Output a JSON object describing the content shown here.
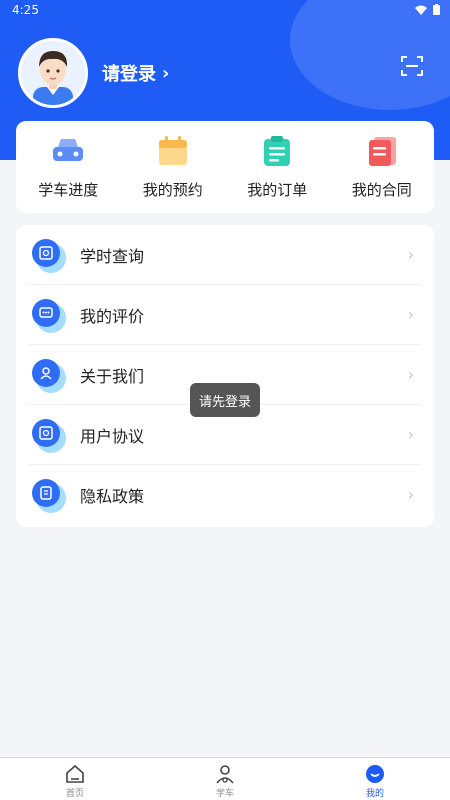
{
  "status_bar": {
    "time": "4:25"
  },
  "profile": {
    "login_text": "请登录",
    "chevron": "›"
  },
  "quick_actions": [
    {
      "label": "学车进度",
      "icon": "car-icon",
      "color": "#5b8cf7"
    },
    {
      "label": "我的预约",
      "icon": "calendar-icon",
      "color": "#f8c55a"
    },
    {
      "label": "我的订单",
      "icon": "clipboard-icon",
      "color": "#2fd0b4"
    },
    {
      "label": "我的合同",
      "icon": "document-icon",
      "color": "#f05a5a"
    }
  ],
  "menu": [
    {
      "label": "学时查询",
      "icon": "search-document-icon"
    },
    {
      "label": "我的评价",
      "icon": "comment-icon"
    },
    {
      "label": "关于我们",
      "icon": "user-icon"
    },
    {
      "label": "用户协议",
      "icon": "search-document-icon"
    },
    {
      "label": "隐私政策",
      "icon": "document-icon"
    }
  ],
  "toast": "请先登录",
  "tabs": [
    {
      "label": "首页",
      "icon": "home-icon",
      "active": false
    },
    {
      "label": "学车",
      "icon": "driver-icon",
      "active": false
    },
    {
      "label": "我的",
      "icon": "profile-icon",
      "active": true
    }
  ],
  "colors": {
    "primary": "#1f5bf5",
    "accent": "#2f6df6",
    "background": "#f4f5f9"
  }
}
